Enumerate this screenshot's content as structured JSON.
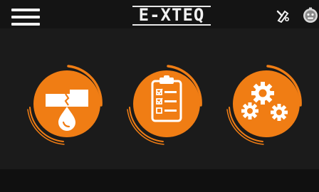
{
  "header": {
    "brand": "E-XTEQ",
    "menu_icon": "hamburger-menu-icon",
    "edit_icon": "edit-tools-icon",
    "user_icon": "robot-face-icon"
  },
  "tiles": [
    {
      "icon": "fluid-drop-icon"
    },
    {
      "icon": "clipboard-checklist-icon"
    },
    {
      "icon": "gears-settings-icon"
    }
  ],
  "colors": {
    "accent": "#f07d14",
    "background": "#1b1b1b",
    "topbar": "#141414",
    "bottombar": "#101010"
  }
}
